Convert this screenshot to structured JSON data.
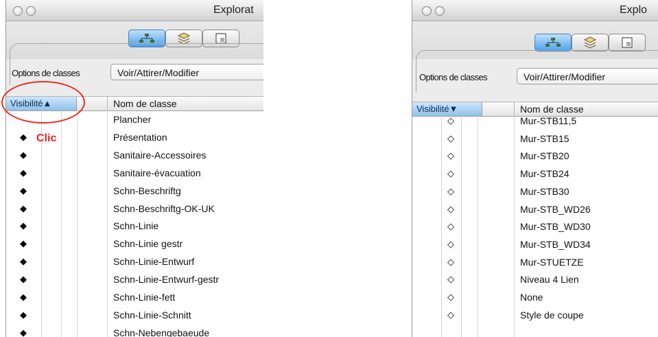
{
  "left_window": {
    "title": "Explorat",
    "options_label": "Options de classes",
    "dropdown_value": "Voir/Attirer/Modifier",
    "header": {
      "visibility": "Visibilité▲",
      "name": "Nom de classe"
    },
    "rows": [
      {
        "vis": "",
        "name": "Plancher"
      },
      {
        "vis": "◆",
        "name": "Présentation"
      },
      {
        "vis": "◆",
        "name": "Sanitaire-Accessoires"
      },
      {
        "vis": "◆",
        "name": "Sanitaire-évacuation"
      },
      {
        "vis": "◆",
        "name": "Schn-Beschriftg"
      },
      {
        "vis": "◆",
        "name": "Schn-Beschriftg-OK-UK"
      },
      {
        "vis": "◆",
        "name": "Schn-Linie"
      },
      {
        "vis": "◆",
        "name": "Schn-Linie gestr"
      },
      {
        "vis": "◆",
        "name": "Schn-Linie-Entwurf"
      },
      {
        "vis": "◆",
        "name": "Schn-Linie-Entwurf-gestr"
      },
      {
        "vis": "◆",
        "name": "Schn-Linie-fett"
      },
      {
        "vis": "◆",
        "name": "Schn-Linie-Schnitt"
      },
      {
        "vis": "◆",
        "name": "Schn-Nebengebaeude"
      }
    ]
  },
  "right_window": {
    "title": "Explo",
    "options_label": "Options de classes",
    "dropdown_value": "Voir/Attirer/Modifier",
    "header": {
      "visibility": "Visibilité▼",
      "name": "Nom de classe"
    },
    "rows": [
      {
        "vis": "◇",
        "name": "Mur-STB11,5"
      },
      {
        "vis": "◇",
        "name": "Mur-STB15"
      },
      {
        "vis": "◇",
        "name": "Mur-STB20"
      },
      {
        "vis": "◇",
        "name": "Mur-STB24"
      },
      {
        "vis": "◇",
        "name": "Mur-STB30"
      },
      {
        "vis": "◇",
        "name": "Mur-STB_WD26"
      },
      {
        "vis": "◇",
        "name": "Mur-STB_WD30"
      },
      {
        "vis": "◇",
        "name": "Mur-STB_WD34"
      },
      {
        "vis": "◇",
        "name": "Mur-STUETZE"
      },
      {
        "vis": "◇",
        "name": "Niveau 4 Lien"
      },
      {
        "vis": "◇",
        "name": "None"
      },
      {
        "vis": "◇",
        "name": "Style de coupe"
      }
    ]
  },
  "annotation": {
    "clic_label": "Clic",
    "color": "#e8251c"
  },
  "colors": {
    "selected_header": "#8fc0ea",
    "selected_segment": "#4ea1ea"
  }
}
